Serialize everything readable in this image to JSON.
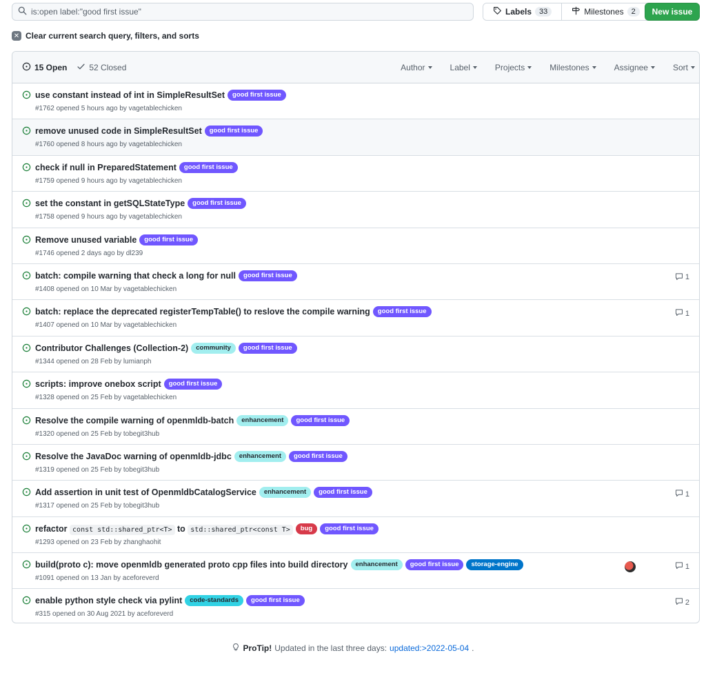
{
  "search": {
    "value": "is:open label:\"good first issue\""
  },
  "toolbar": {
    "labels_label": "Labels",
    "labels_count": "33",
    "milestones_label": "Milestones",
    "milestones_count": "2",
    "new_issue_label": "New issue"
  },
  "clear": {
    "label": "Clear current search query, filters, and sorts"
  },
  "header": {
    "open_label": "15 Open",
    "closed_label": "52 Closed",
    "filters": [
      "Author",
      "Label",
      "Projects",
      "Milestones",
      "Assignee",
      "Sort"
    ]
  },
  "label_colors": {
    "good first issue": {
      "bg": "#7057ff",
      "fg": "#ffffff"
    },
    "community": {
      "bg": "#a2eeef",
      "fg": "#24292f"
    },
    "enhancement": {
      "bg": "#a2eeef",
      "fg": "#24292f"
    },
    "bug": {
      "bg": "#d73a4a",
      "fg": "#ffffff"
    },
    "storage-engine": {
      "bg": "#0075ca",
      "fg": "#ffffff"
    },
    "code-standards": {
      "bg": "#31d2e4",
      "fg": "#24292f"
    }
  },
  "issues": [
    {
      "title": "use constant instead of int in SimpleResultSet",
      "labels": [
        "good first issue"
      ],
      "meta": "#1762 opened 5 hours ago by vagetablechicken",
      "comments": ""
    },
    {
      "title": "remove unused code in SimpleResultSet",
      "labels": [
        "good first issue"
      ],
      "meta": "#1760 opened 8 hours ago by vagetablechicken",
      "comments": ""
    },
    {
      "title": "check if null in PreparedStatement",
      "labels": [
        "good first issue"
      ],
      "meta": "#1759 opened 9 hours ago by vagetablechicken",
      "comments": ""
    },
    {
      "title": "set the constant in getSQLStateType",
      "labels": [
        "good first issue"
      ],
      "meta": "#1758 opened 9 hours ago by vagetablechicken",
      "comments": ""
    },
    {
      "title": "Remove unused variable",
      "labels": [
        "good first issue"
      ],
      "meta": "#1746 opened 2 days ago by dl239",
      "comments": ""
    },
    {
      "title": "batch: compile warning that check a long for null",
      "labels": [
        "good first issue"
      ],
      "meta": "#1408 opened on 10 Mar by vagetablechicken",
      "comments": "1"
    },
    {
      "title": "batch: replace the deprecated registerTempTable() to reslove the compile warning",
      "labels": [
        "good first issue"
      ],
      "meta": "#1407 opened on 10 Mar by vagetablechicken",
      "comments": "1"
    },
    {
      "title": "Contributor Challenges (Collection-2)",
      "labels": [
        "community",
        "good first issue"
      ],
      "meta": "#1344 opened on 28 Feb by lumianph",
      "comments": ""
    },
    {
      "title": "scripts: improve onebox script",
      "labels": [
        "good first issue"
      ],
      "meta": "#1328 opened on 25 Feb by vagetablechicken",
      "comments": ""
    },
    {
      "title": "Resolve the compile warning of openmldb-batch",
      "labels": [
        "enhancement",
        "good first issue"
      ],
      "meta": "#1320 opened on 25 Feb by tobegit3hub",
      "comments": ""
    },
    {
      "title": "Resolve the JavaDoc warning of openmldb-jdbc",
      "labels": [
        "enhancement",
        "good first issue"
      ],
      "meta": "#1319 opened on 25 Feb by tobegit3hub",
      "comments": ""
    },
    {
      "title": "Add assertion in unit test of OpenmldbCatalogService",
      "labels": [
        "enhancement",
        "good first issue"
      ],
      "meta": "#1317 opened on 25 Feb by tobegit3hub",
      "comments": "1"
    },
    {
      "title_parts": [
        "refactor ",
        "const std::shared_ptr<T>",
        " to ",
        "std::shared_ptr<const T>"
      ],
      "labels": [
        "bug",
        "good first issue"
      ],
      "meta": "#1293 opened on 23 Feb by zhanghaohit",
      "comments": ""
    },
    {
      "title": "build(proto c): move openmldb generated proto cpp files into build directory",
      "labels": [
        "enhancement",
        "good first issue",
        "storage-engine"
      ],
      "meta": "#1091 opened on 13 Jan by aceforeverd",
      "comments": "1",
      "avatar": true
    },
    {
      "title": "enable python style check via pylint",
      "labels": [
        "code-standards",
        "good first issue"
      ],
      "meta": "#315 opened on 30 Aug 2021 by aceforeverd",
      "comments": "2"
    }
  ],
  "protip": {
    "label": "ProTip!",
    "text": "Updated in the last three days:",
    "link": "updated:>2022-05-04",
    "suffix": "."
  }
}
